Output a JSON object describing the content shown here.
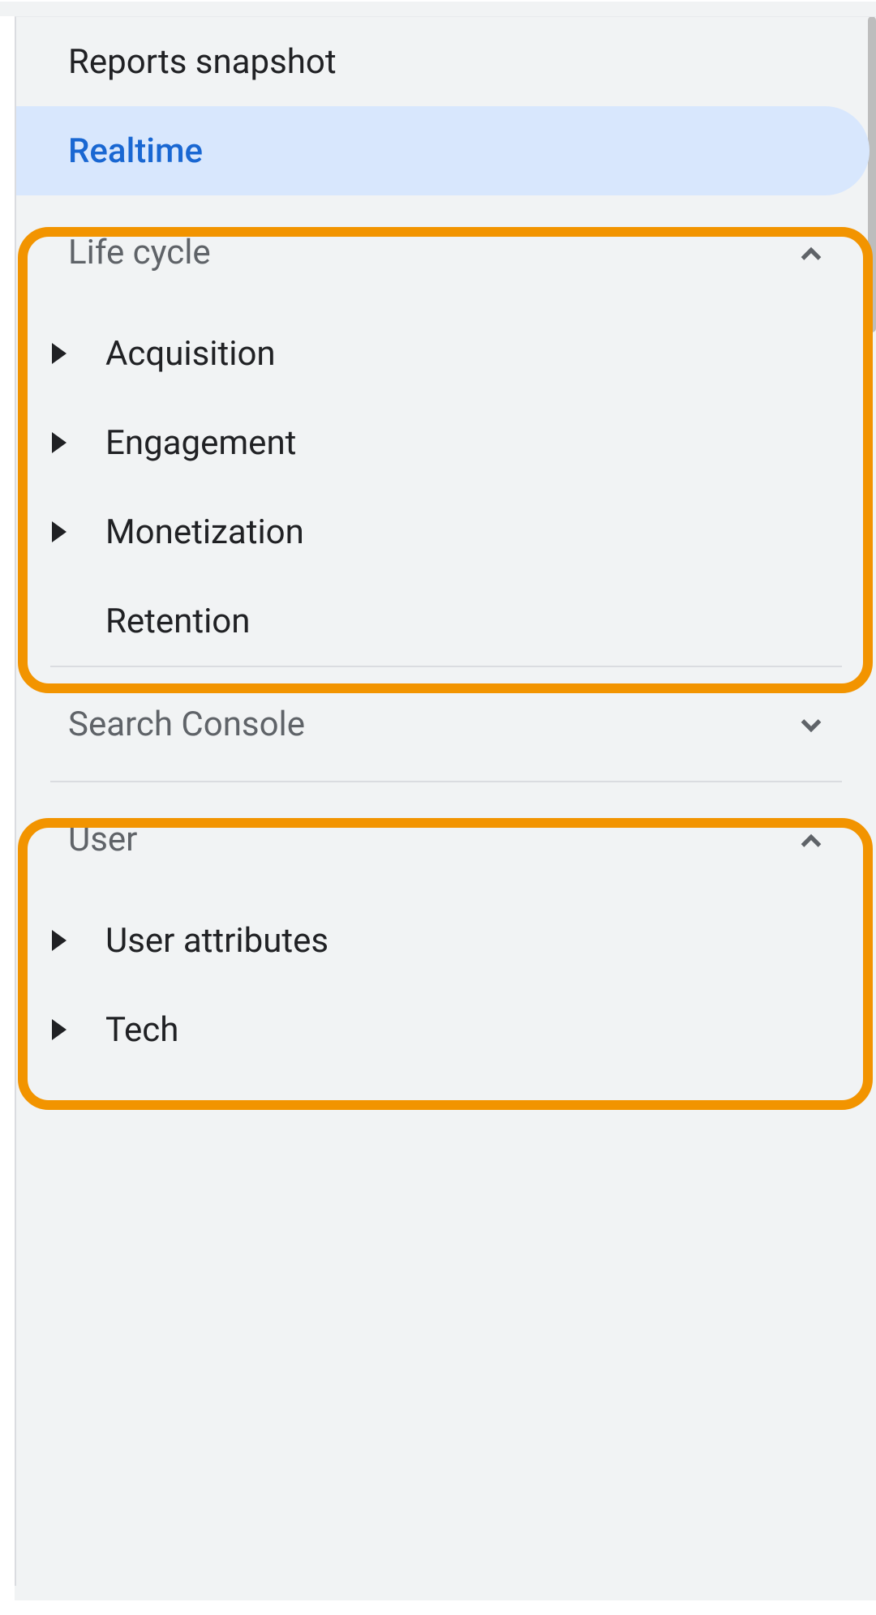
{
  "nav": {
    "reports_snapshot": "Reports snapshot",
    "realtime": "Realtime"
  },
  "sections": {
    "life_cycle": {
      "label": "Life cycle",
      "items": [
        {
          "label": "Acquisition",
          "expandable": true
        },
        {
          "label": "Engagement",
          "expandable": true
        },
        {
          "label": "Monetization",
          "expandable": true
        },
        {
          "label": "Retention",
          "expandable": false
        }
      ]
    },
    "search_console": {
      "label": "Search Console"
    },
    "user": {
      "label": "User",
      "items": [
        {
          "label": "User attributes",
          "expandable": true
        },
        {
          "label": "Tech",
          "expandable": true
        }
      ]
    }
  }
}
